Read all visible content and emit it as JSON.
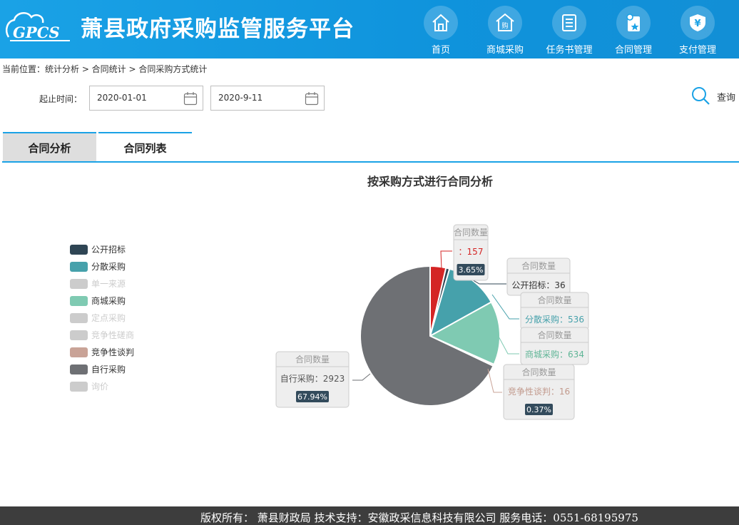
{
  "header": {
    "logo_text": "GPCS",
    "title": "萧县政府采购监管服务平台",
    "nav": [
      {
        "label": "首页",
        "icon": "home-icon"
      },
      {
        "label": "商城采购",
        "icon": "shop-icon"
      },
      {
        "label": "任务书管理",
        "icon": "document-icon"
      },
      {
        "label": "合同管理",
        "icon": "contract-icon"
      },
      {
        "label": "支付管理",
        "icon": "shield-yen-icon"
      }
    ]
  },
  "breadcrumb": "当前位置：统计分析 > 合同统计 > 合同采购方式统计",
  "filter": {
    "date_label": "起止时间：",
    "start_date": "2020-01-01",
    "end_date": "2020-9-11",
    "query_label": "查询"
  },
  "tabs": [
    "合同分析",
    "合同列表"
  ],
  "chart_data": {
    "type": "pie",
    "title": "按采购方式进行合同分析",
    "tooltip_title": "合同数量",
    "legend_position": "left",
    "series": [
      {
        "name": "公开招标",
        "value": 36,
        "color": "#2f4554",
        "active": true
      },
      {
        "name": "分散采购",
        "value": 536,
        "color": "#46a1ab",
        "active": true
      },
      {
        "name": "单一来源",
        "value": null,
        "color": "#cccccc",
        "active": false
      },
      {
        "name": "商城采购",
        "value": 634,
        "color": "#7fcab2",
        "active": true
      },
      {
        "name": "定点采购",
        "value": null,
        "color": "#cccccc",
        "active": false
      },
      {
        "name": "竞争性磋商",
        "value": null,
        "color": "#cccccc",
        "active": false
      },
      {
        "name": "竞争性谈判",
        "value": 16,
        "color": "#c9a397",
        "active": true
      },
      {
        "name": "自行采购",
        "value": 2923,
        "color": "#6e7074",
        "active": true
      },
      {
        "name": "询价",
        "value": null,
        "color": "#cccccc",
        "active": false
      }
    ],
    "unnamed_slice": {
      "name": "",
      "value": 157,
      "color": "#d42525"
    },
    "labels": [
      {
        "text": "：157",
        "percent": "3.65%",
        "color": "#d42525"
      },
      {
        "text": "公开招标：36",
        "percent": "",
        "color": "#333333"
      },
      {
        "text": "分散采购：536",
        "percent": "",
        "color": "#46a1ab"
      },
      {
        "text": "商城采购：634",
        "percent": "",
        "color": "#5fb596"
      },
      {
        "text": "竞争性谈判：16",
        "percent": "0.37%",
        "color": "#c29a8d"
      },
      {
        "text": "自行采购：2923",
        "percent": "67.94%",
        "color": "#555555"
      }
    ]
  },
  "footer": "版权所有： 萧县财政局 技术支持：安徽政采信息科技有限公司 服务电话：0551-68195975"
}
